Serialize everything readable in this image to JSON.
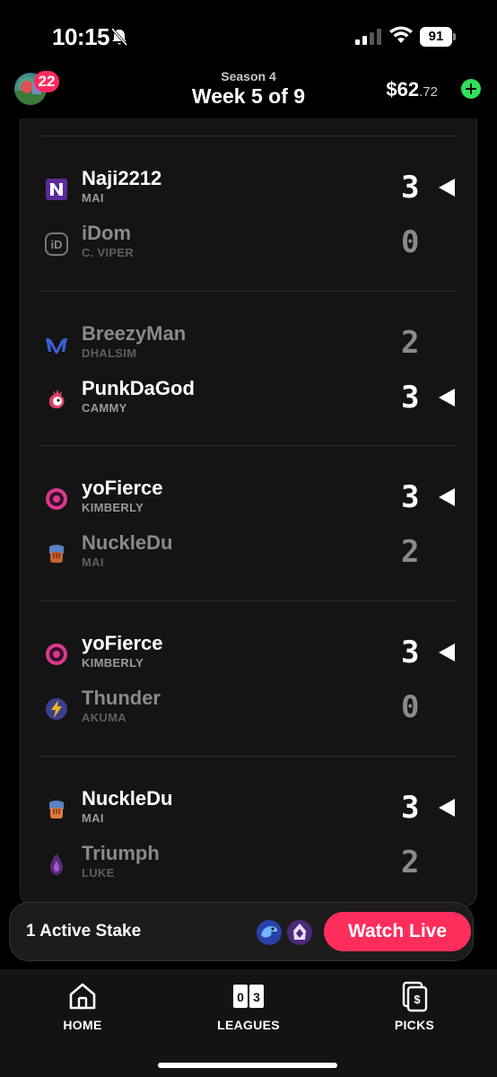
{
  "status_bar": {
    "time": "10:15",
    "battery": "91"
  },
  "header": {
    "notification_count": "22",
    "season": "Season 4",
    "week": "Week 5 of 9",
    "balance_dollars": "$62",
    "balance_cents": ".72"
  },
  "matches": [
    {
      "top": {
        "name": "Naji2212",
        "character": "MAI",
        "score": "3",
        "result": "win",
        "logo_icon": "n-logo-icon"
      },
      "bottom": {
        "name": "iDom",
        "character": "C. VIPER",
        "score": "0",
        "result": "lose",
        "logo_icon": "id-logo-icon"
      }
    },
    {
      "top": {
        "name": "BreezyMan",
        "character": "DHALSIM",
        "score": "2",
        "result": "lose",
        "logo_icon": "m-logo-icon"
      },
      "bottom": {
        "name": "PunkDaGod",
        "character": "CAMMY",
        "score": "3",
        "result": "win",
        "logo_icon": "rooster-logo-icon"
      }
    },
    {
      "top": {
        "name": "yoFierce",
        "character": "KIMBERLY",
        "score": "3",
        "result": "win",
        "logo_icon": "flower-logo-icon"
      },
      "bottom": {
        "name": "NuckleDu",
        "character": "MAI",
        "score": "2",
        "result": "lose",
        "logo_icon": "fist-logo-icon"
      }
    },
    {
      "top": {
        "name": "yoFierce",
        "character": "KIMBERLY",
        "score": "3",
        "result": "win",
        "logo_icon": "flower-logo-icon"
      },
      "bottom": {
        "name": "Thunder",
        "character": "AKUMA",
        "score": "0",
        "result": "lose",
        "logo_icon": "lightning-logo-icon"
      }
    },
    {
      "top": {
        "name": "NuckleDu",
        "character": "MAI",
        "score": "3",
        "result": "win",
        "logo_icon": "fist-logo-icon"
      },
      "bottom": {
        "name": "Triumph",
        "character": "LUKE",
        "score": "2",
        "result": "lose",
        "logo_icon": "flame-logo-icon"
      }
    }
  ],
  "stake_bar": {
    "label": "1 Active Stake",
    "participant_icons": [
      "serpent-logo-icon",
      "hooded-logo-icon"
    ],
    "watch_button": "Watch Live"
  },
  "tabs": [
    {
      "label": "HOME",
      "icon": "home-icon"
    },
    {
      "label": "LEAGUES",
      "icon": "scoreboard-icon"
    },
    {
      "label": "PICKS",
      "icon": "cards-dollar-icon"
    }
  ],
  "colors": {
    "accent": "#ff2d5c",
    "add_funds": "#2ee05a",
    "badge": "#ff2a5f"
  }
}
